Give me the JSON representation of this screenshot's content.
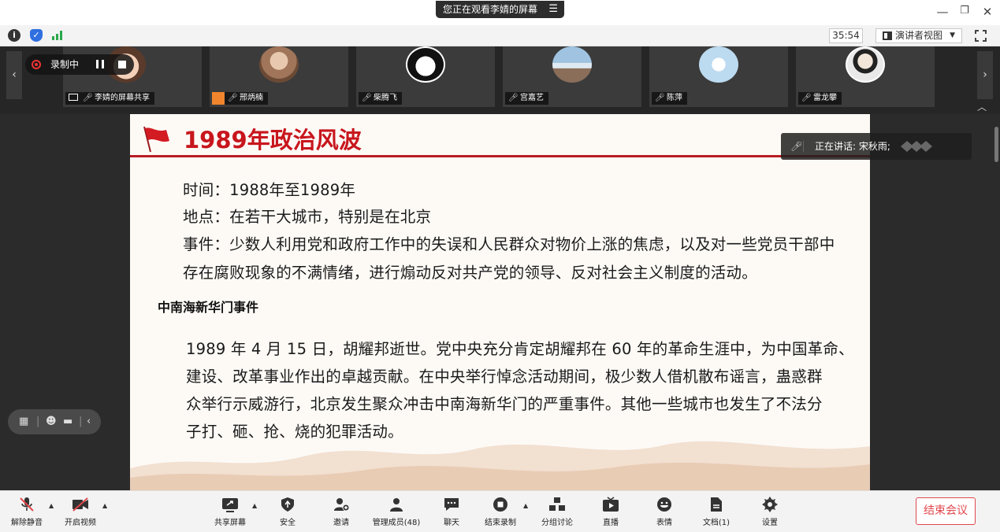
{
  "banner": {
    "text": "您正在观看李婧的屏幕",
    "menu_glyph": "☰"
  },
  "window": {
    "minimize": "—",
    "restore": "❐",
    "close": "✕"
  },
  "status": {
    "timer": "35:54",
    "view_mode": "演讲者视图"
  },
  "recording": {
    "label": "录制中"
  },
  "participants": [
    {
      "name": "李婧的屏幕共享"
    },
    {
      "name": "邢炳楠"
    },
    {
      "name": "柴腾飞"
    },
    {
      "name": "宫嘉艺"
    },
    {
      "name": "陈萍"
    },
    {
      "name": "雷龙攀"
    }
  ],
  "speaking": {
    "label": "正在讲话: 宋秋雨;"
  },
  "slide": {
    "title": "1989年政治风波",
    "lines": [
      "时间：1988年至1989年",
      "地点：在若干大城市，特别是在北京",
      "事件：少数人利用党和政府工作中的失误和人民群众对物价上涨的焦虑，以及对一些党员干部中",
      "存在腐败现象的不满情绪，进行煽动反对共产党的领导、反对社会主义制度的活动。"
    ],
    "subheading": "中南海新华门事件",
    "paragraph": [
      "1989 年 4 月 15 日，胡耀邦逝世。党中央充分肯定胡耀邦在 60 年的革命生涯中，为中国革命、",
      "建设、改革事业作出的卓越贡献。在中央举行悼念活动期间，极少数人借机散布谣言，蛊惑群",
      "众举行示威游行，北京发生聚众冲击中南海新华门的严重事件。其他一些城市也发生了不法分",
      "子打、砸、抢、烧的犯罪活动。"
    ]
  },
  "toolbar": {
    "unmute": "解除静音",
    "start_video": "开启视频",
    "share_screen": "共享屏幕",
    "security": "安全",
    "invite": "邀请",
    "manage_members": "管理成员(48)",
    "chat": "聊天",
    "end_recording": "结束录制",
    "breakout": "分组讨论",
    "live": "直播",
    "reactions": "表情",
    "docs": "文档(1)",
    "settings": "设置",
    "end_meeting": "结束会议"
  },
  "colors": {
    "title_red": "#c8161d",
    "end_red": "#e0474c",
    "signal_green": "#2aa84a",
    "shield_blue": "#2f6fe0"
  }
}
